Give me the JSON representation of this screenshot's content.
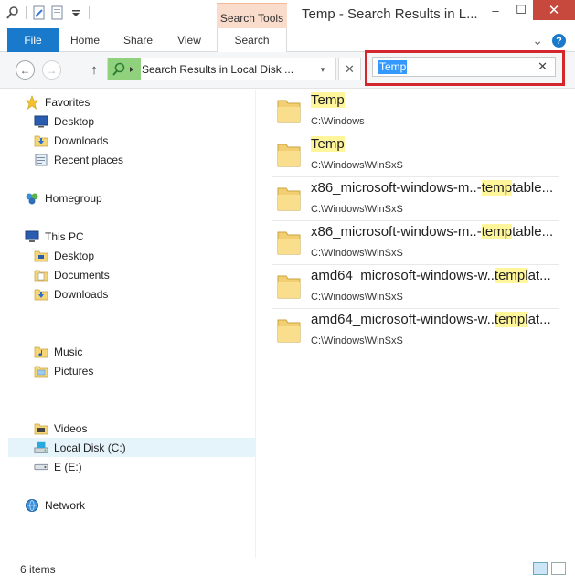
{
  "window": {
    "title": "Temp - Search Results in L...",
    "contextual_tab": "Search Tools",
    "minimize": "–",
    "maximize": "☐",
    "close": "✕"
  },
  "ribbon": {
    "tabs": [
      {
        "label": "File"
      },
      {
        "label": "Home"
      },
      {
        "label": "Share"
      },
      {
        "label": "View"
      },
      {
        "label": "Search"
      }
    ],
    "collapse_icon": "⌄",
    "help_label": "?"
  },
  "navigation": {
    "back_glyph": "←",
    "forward_glyph": "→",
    "up_glyph": "↑",
    "address": "Search Results in Local Disk ...",
    "dropdown_glyph": "▾",
    "clear_glyph": "✕",
    "search_value": "Temp",
    "search_clear_glyph": "✕"
  },
  "sidebar": {
    "favorites": {
      "label": "Favorites",
      "items": [
        {
          "label": "Desktop"
        },
        {
          "label": "Downloads"
        },
        {
          "label": "Recent places"
        }
      ]
    },
    "homegroup": {
      "label": "Homegroup"
    },
    "this_pc": {
      "label": "This PC",
      "items": [
        {
          "label": "Desktop"
        },
        {
          "label": "Documents"
        },
        {
          "label": "Downloads"
        },
        {
          "label": "Music"
        },
        {
          "label": "Pictures"
        },
        {
          "label": "Videos"
        },
        {
          "label": "Local Disk (C:)"
        },
        {
          "label": "E (E:)"
        }
      ]
    },
    "network": {
      "label": "Network"
    }
  },
  "results": [
    {
      "pre": "",
      "hl": "Temp",
      "post": "",
      "path": "C:\\Windows"
    },
    {
      "pre": "",
      "hl": "Temp",
      "post": "",
      "path": "C:\\Windows\\WinSxS"
    },
    {
      "pre": "x86_microsoft-windows-m..-",
      "hl": "temp",
      "post": "table...",
      "path": "C:\\Windows\\WinSxS"
    },
    {
      "pre": "x86_microsoft-windows-m..-",
      "hl": "temp",
      "post": "table...",
      "path": "C:\\Windows\\WinSxS"
    },
    {
      "pre": "amd64_microsoft-windows-w..",
      "hl": "templ",
      "post": "at...",
      "path": "C:\\Windows\\WinSxS"
    },
    {
      "pre": "amd64_microsoft-windows-w..",
      "hl": "templ",
      "post": "at...",
      "path": "C:\\Windows\\WinSxS"
    }
  ],
  "status": {
    "item_count": "6 items"
  },
  "colors": {
    "accent": "#1979ca",
    "search_tools_tab": "#f9dccb",
    "highlight_box": "#d4262d",
    "match_highlight": "#fff59b",
    "selection": "#e5f3fb"
  }
}
